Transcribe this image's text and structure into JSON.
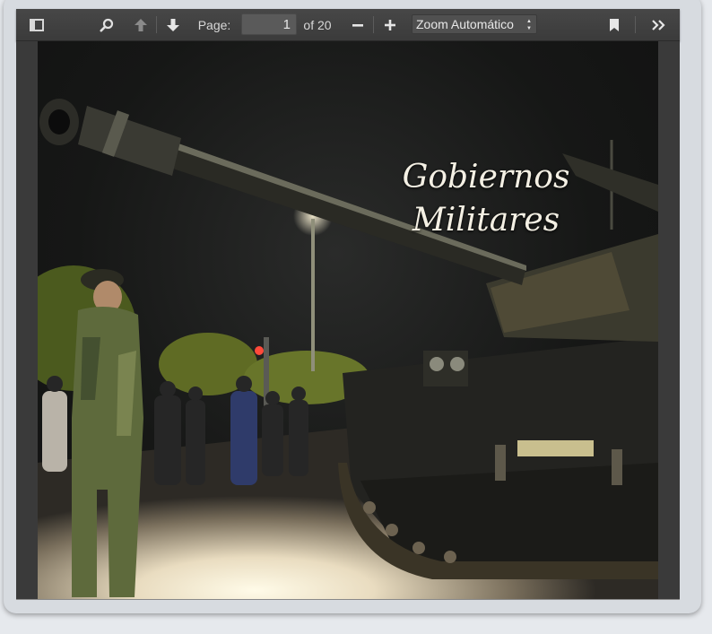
{
  "toolbar": {
    "sidebar_toggle_icon": "sidebar-toggle-icon",
    "search_icon": "search-icon",
    "prev_icon": "arrow-up-icon",
    "next_icon": "arrow-down-icon",
    "page_label": "Page:",
    "page_value": "1",
    "page_total": "of 20",
    "zoom_out_icon": "minus-icon",
    "zoom_in_icon": "plus-icon",
    "zoom_value": "Zoom Automático",
    "bookmark_icon": "bookmark-icon",
    "more_icon": "double-chevron-right-icon"
  },
  "document": {
    "title_line1": "Gobiernos",
    "title_line2": "Militares"
  },
  "colors": {
    "toolbar_bg": "#434343",
    "viewer_bg": "#404040",
    "page_bg": "#151615"
  }
}
